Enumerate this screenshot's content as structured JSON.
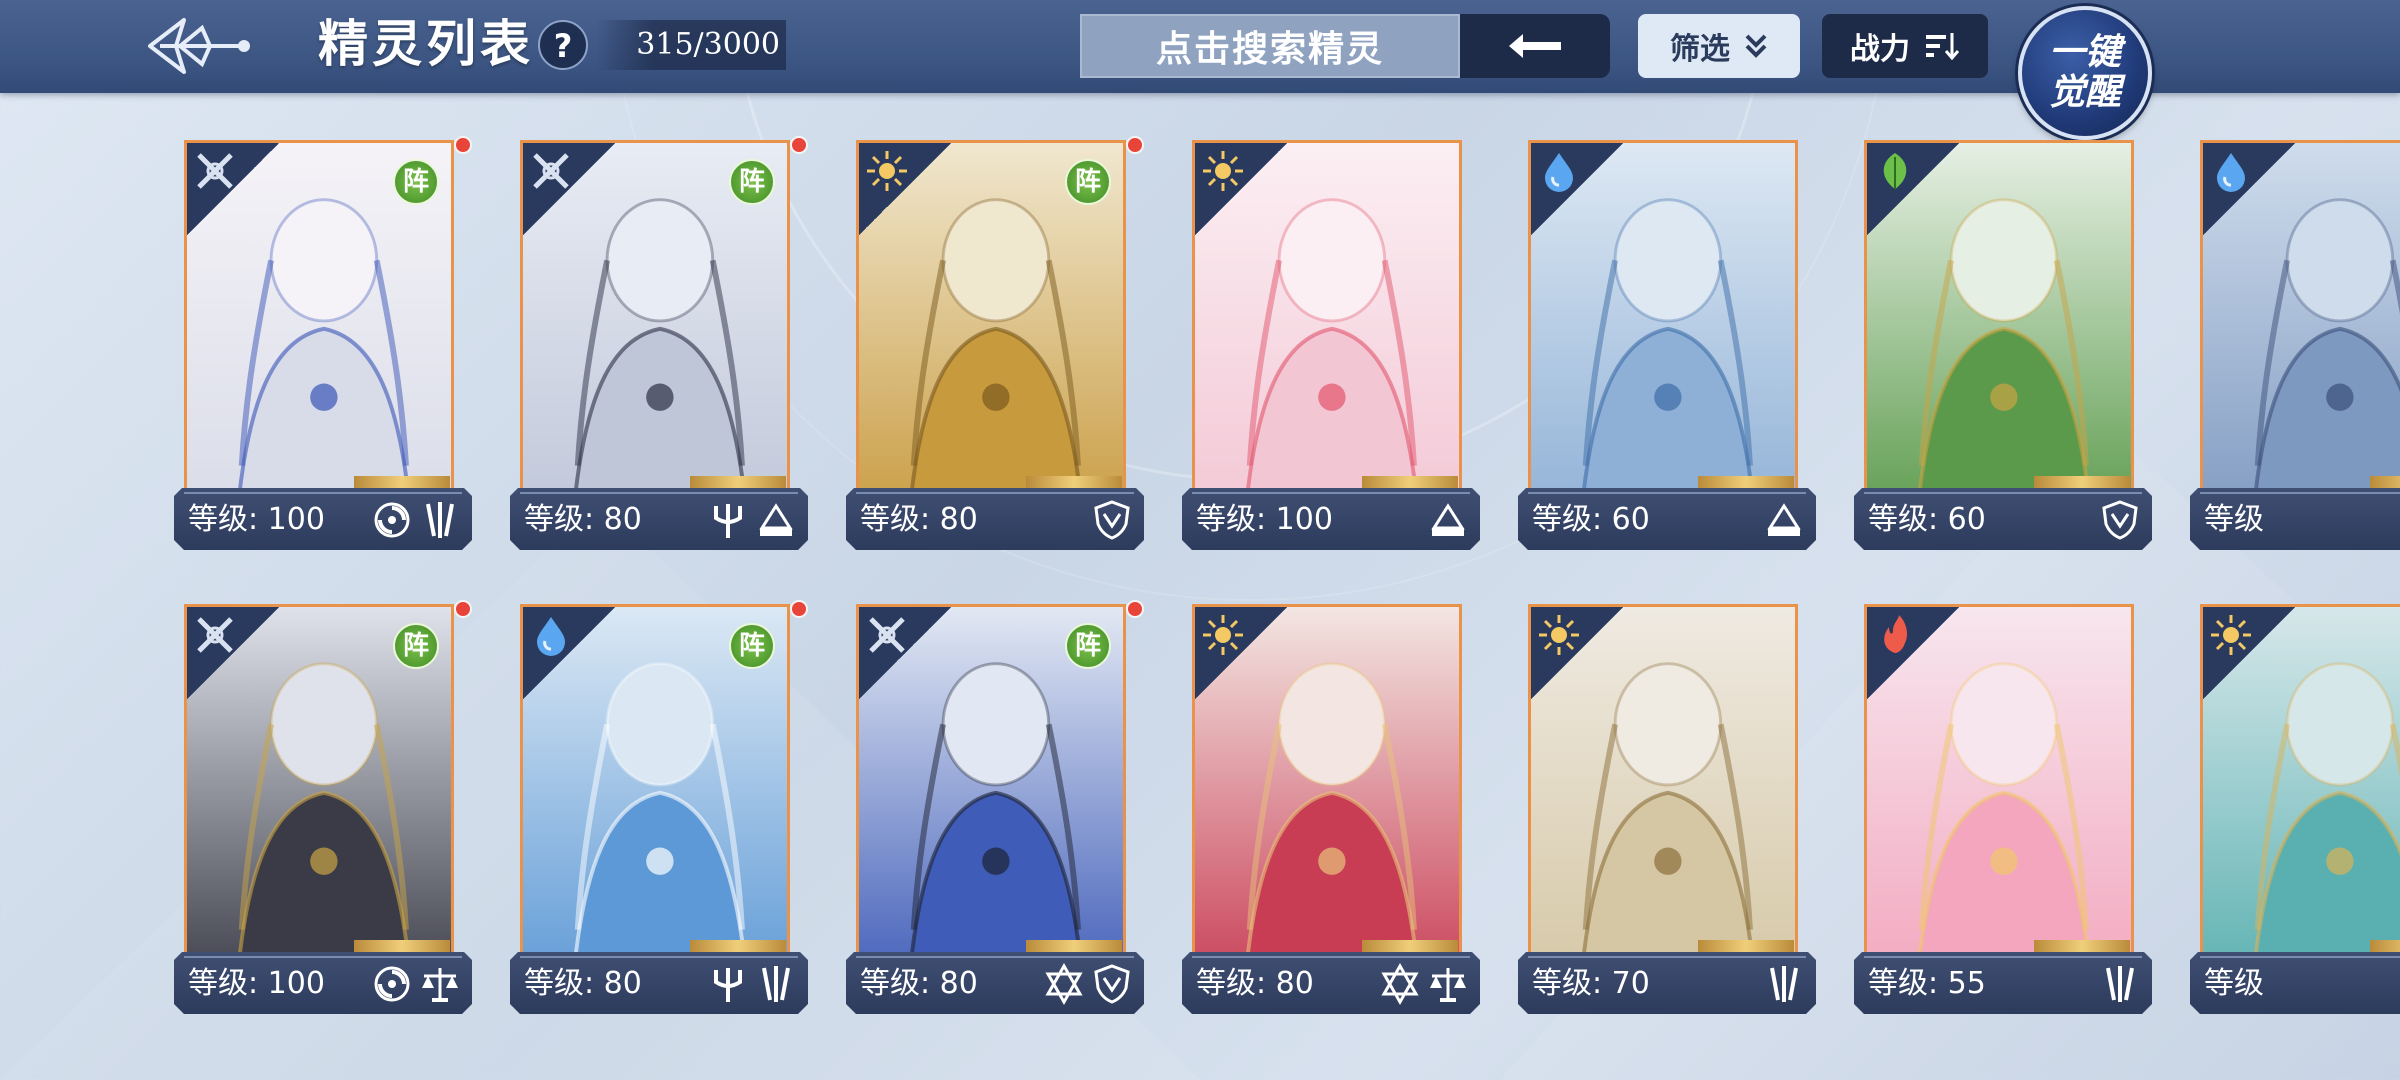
{
  "header": {
    "title": "精灵列表",
    "help_label": "?",
    "count": "315/3000",
    "search_placeholder": "点击搜索精灵",
    "filter_label": "筛选",
    "sort_label": "战力",
    "awaken_line1": "一键",
    "awaken_line2": "觉醒"
  },
  "colors": {
    "topbar": "#3b5482",
    "card_border": "#e8924a",
    "footer": "#2d3b5c",
    "formation_green": "#4f9a2e",
    "notify_red": "#e8443a"
  },
  "cards_row1": [
    {
      "level": "等级: 100",
      "element": "neutral-x-icon",
      "formation": "阵",
      "notify": true,
      "traits": [
        "vortex-icon",
        "claw-icon"
      ],
      "art": "white-haired-maiden"
    },
    {
      "level": "等级: 80",
      "element": "neutral-x-icon",
      "formation": "阵",
      "notify": true,
      "traits": [
        "trident-icon",
        "scroll-icon"
      ],
      "art": "silver-horned-knight"
    },
    {
      "level": "等级: 80",
      "element": "light-star-icon",
      "formation": "阵",
      "notify": true,
      "traits": [
        "shield-icon"
      ],
      "art": "golden-dragon"
    },
    {
      "level": "等级: 100",
      "element": "light-star-icon",
      "formation": "",
      "notify": false,
      "traits": [
        "scroll-icon"
      ],
      "art": "pink-fox"
    },
    {
      "level": "等级: 60",
      "element": "water-drop-icon",
      "formation": "",
      "notify": false,
      "traits": [
        "scroll-icon"
      ],
      "art": "ice-dragon"
    },
    {
      "level": "等级: 60",
      "element": "grass-leaf-icon",
      "formation": "",
      "notify": false,
      "traits": [
        "shield-icon"
      ],
      "art": "green-dragon"
    },
    {
      "level": "等级",
      "element": "water-drop-icon",
      "formation": "",
      "notify": false,
      "traits": [],
      "art": "partial-blue"
    }
  ],
  "cards_row2": [
    {
      "level": "等级: 100",
      "element": "neutral-x-icon",
      "formation": "阵",
      "notify": true,
      "traits": [
        "vortex-icon",
        "scales-icon"
      ],
      "art": "dark-horned-lord"
    },
    {
      "level": "等级: 80",
      "element": "water-drop-icon",
      "formation": "阵",
      "notify": true,
      "traits": [
        "trident-icon",
        "claw-icon"
      ],
      "art": "blue-haired-sage"
    },
    {
      "level": "等级: 80",
      "element": "neutral-x-icon",
      "formation": "阵",
      "notify": true,
      "traits": [
        "hexagram-icon",
        "shield-icon"
      ],
      "art": "blue-horned-youth"
    },
    {
      "level": "等级: 80",
      "element": "light-star-icon",
      "formation": "",
      "notify": false,
      "traits": [
        "hexagram-icon",
        "scales-icon"
      ],
      "art": "red-feather-warrior"
    },
    {
      "level": "等级: 70",
      "element": "light-star-icon",
      "formation": "",
      "notify": false,
      "traits": [
        "claw-icon"
      ],
      "art": "golden-armored-ram"
    },
    {
      "level": "等级: 55",
      "element": "fire-flame-icon",
      "formation": "",
      "notify": false,
      "traits": [
        "claw-icon"
      ],
      "art": "pink-catgirl"
    },
    {
      "level": "等级",
      "element": "light-star-icon",
      "formation": "",
      "notify": false,
      "traits": [],
      "art": "partial-teal"
    }
  ]
}
